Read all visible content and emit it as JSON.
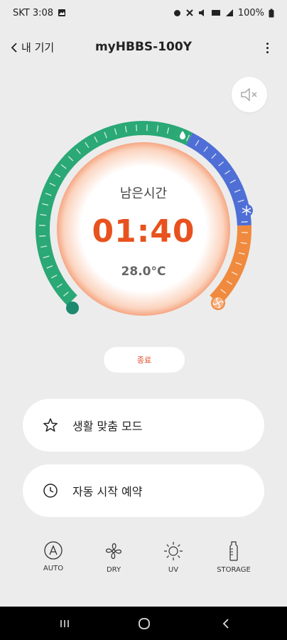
{
  "status": {
    "carrier_time": "SKT 3:08",
    "battery": "100%"
  },
  "appbar": {
    "back_label": "내 기기",
    "title": "myHBBS-100Y"
  },
  "main": {
    "remaining_label": "남은시간",
    "remaining_time": "01:40",
    "temperature": "28.0°C",
    "stop_label": "종료"
  },
  "cards": {
    "life_mode": "생활 맞춤 모드",
    "auto_start": "자동 시작 예약"
  },
  "modes": [
    {
      "label": "AUTO",
      "icon": "auto-icon"
    },
    {
      "label": "DRY",
      "icon": "fan-icon"
    },
    {
      "label": "UV",
      "icon": "sun-icon"
    },
    {
      "label": "STORAGE",
      "icon": "bottle-icon"
    }
  ],
  "colors": {
    "green": "#2aa876",
    "blue": "#4f6fd6",
    "orange": "#f08a3e",
    "time": "#e8521e"
  }
}
